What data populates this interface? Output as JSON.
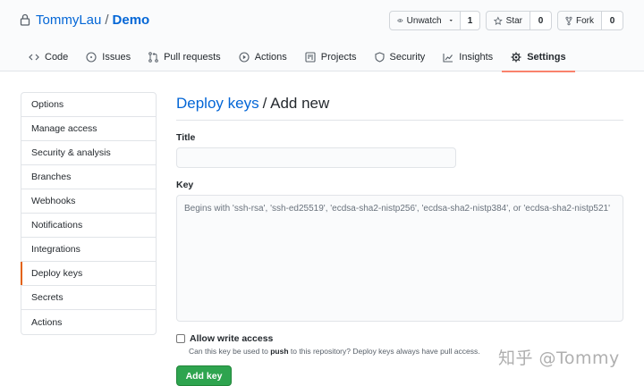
{
  "repo": {
    "owner": "TommyLau",
    "separator": "/",
    "name": "Demo"
  },
  "actions": {
    "unwatch": {
      "label": "Unwatch",
      "count": "1"
    },
    "star": {
      "label": "Star",
      "count": "0"
    },
    "fork": {
      "label": "Fork",
      "count": "0"
    }
  },
  "tabs": [
    {
      "label": "Code",
      "icon": "code-icon"
    },
    {
      "label": "Issues",
      "icon": "issue-icon"
    },
    {
      "label": "Pull requests",
      "icon": "pull-request-icon"
    },
    {
      "label": "Actions",
      "icon": "play-icon"
    },
    {
      "label": "Projects",
      "icon": "project-icon"
    },
    {
      "label": "Security",
      "icon": "shield-icon"
    },
    {
      "label": "Insights",
      "icon": "graph-icon"
    },
    {
      "label": "Settings",
      "icon": "gear-icon",
      "selected": true
    }
  ],
  "sidebar": {
    "items": [
      {
        "label": "Options"
      },
      {
        "label": "Manage access"
      },
      {
        "label": "Security & analysis"
      },
      {
        "label": "Branches"
      },
      {
        "label": "Webhooks"
      },
      {
        "label": "Notifications"
      },
      {
        "label": "Integrations"
      },
      {
        "label": "Deploy keys",
        "selected": true
      },
      {
        "label": "Secrets"
      },
      {
        "label": "Actions"
      }
    ]
  },
  "main": {
    "breadcrumb_link": "Deploy keys",
    "breadcrumb_rest": "/ Add new",
    "title_label": "Title",
    "title_value": "",
    "key_label": "Key",
    "key_placeholder": "Begins with 'ssh-rsa', 'ssh-ed25519', 'ecdsa-sha2-nistp256', 'ecdsa-sha2-nistp384', or 'ecdsa-sha2-nistp521'",
    "write_access_label": "Allow write access",
    "write_access_note_pre": "Can this key be used to",
    "write_access_note_bold": "push",
    "write_access_note_post": "to this repository? Deploy keys always have pull access.",
    "submit_label": "Add key"
  },
  "watermark": "知乎 @Tommy",
  "colors": {
    "link": "#0366d6",
    "accent_tab": "#f9826c",
    "accent_side": "#e36209",
    "primary_button": "#2ea44f"
  }
}
